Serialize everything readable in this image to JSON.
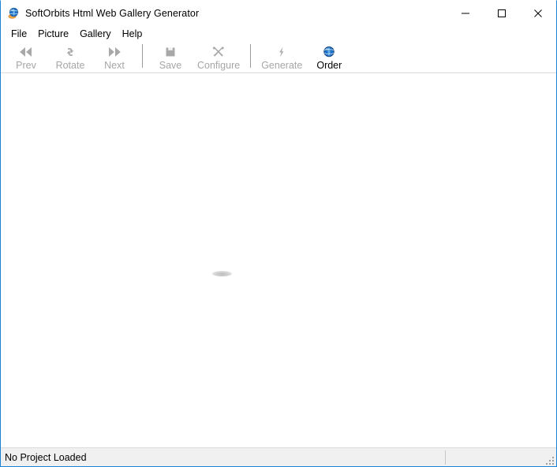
{
  "window": {
    "title": "SoftOrbits Html Web Gallery Generator",
    "app_icon": "globe-icon",
    "accent_color": "#1883d7",
    "controls": {
      "minimize": "minimize-icon",
      "maximize": "maximize-icon",
      "close": "close-icon"
    }
  },
  "menubar": {
    "items": [
      {
        "label": "File"
      },
      {
        "label": "Picture"
      },
      {
        "label": "Gallery"
      },
      {
        "label": "Help"
      }
    ]
  },
  "toolbar": {
    "buttons": [
      {
        "label": "Prev",
        "icon": "arrow-left-double-icon",
        "enabled": false
      },
      {
        "label": "Rotate",
        "icon": "rotate-icon",
        "enabled": false
      },
      {
        "label": "Next",
        "icon": "arrow-right-double-icon",
        "enabled": false
      },
      {
        "label": "Save",
        "icon": "save-icon",
        "enabled": false
      },
      {
        "label": "Configure",
        "icon": "tools-icon",
        "enabled": false
      },
      {
        "label": "Generate",
        "icon": "lightning-bolt-icon",
        "enabled": false
      },
      {
        "label": "Order",
        "icon": "globe-icon",
        "enabled": true
      }
    ],
    "disabled_color": "#a6a6a6",
    "enabled_color": "#000000"
  },
  "client": {
    "background_color": "#ffffff",
    "placeholder_shape": "faint-grey-ellipse"
  },
  "statusbar": {
    "message": "No Project Loaded",
    "secondary": "",
    "background_color": "#f0f0f0"
  }
}
